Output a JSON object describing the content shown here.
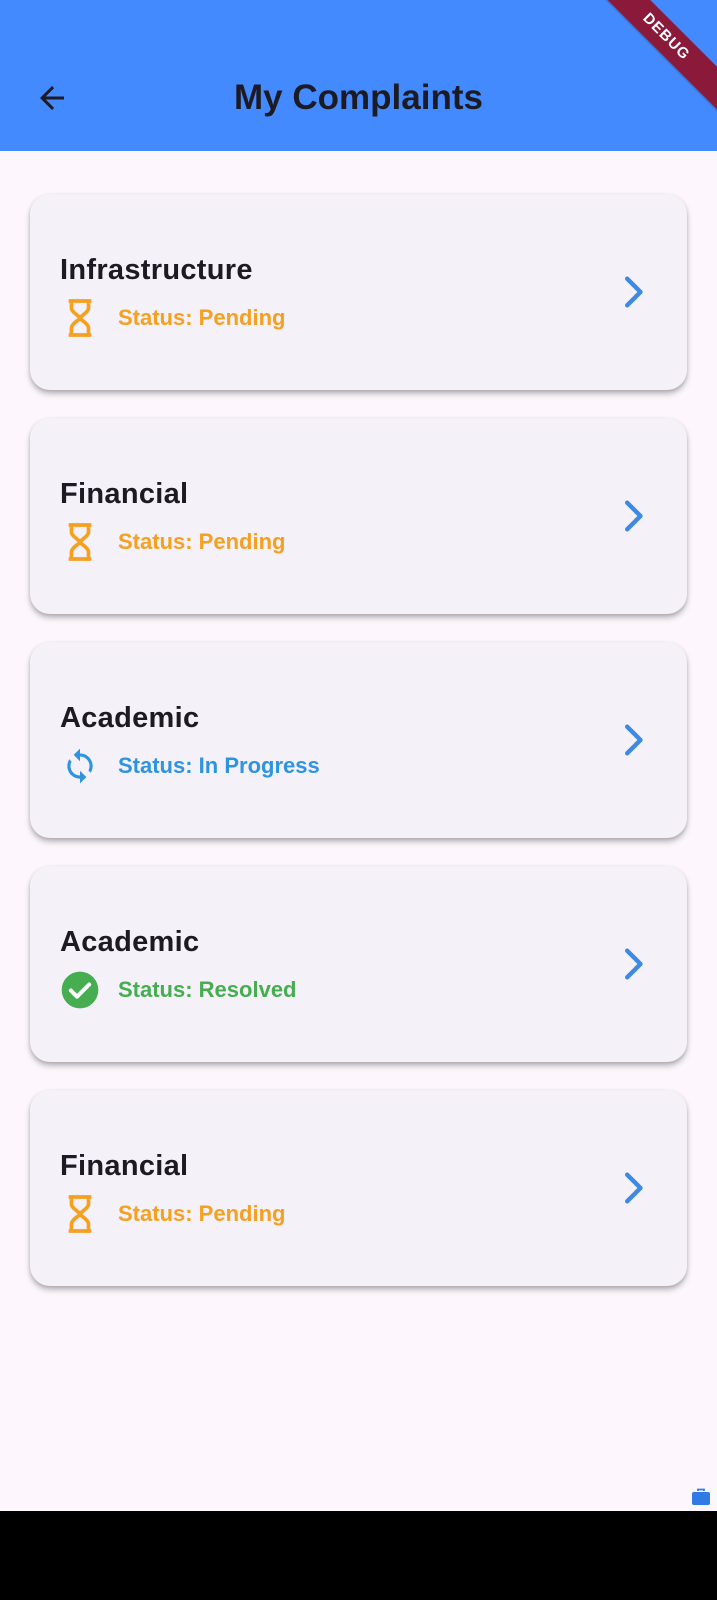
{
  "app_bar": {
    "title": "My Complaints",
    "background_color": "#448aff",
    "back_icon": "arrow-back-icon"
  },
  "debug_banner": {
    "label": "DEBUG"
  },
  "complaints": [
    {
      "category": "Infrastructure",
      "status_text": "Status: Pending",
      "status_icon": "hourglass-icon",
      "status_color": "#f5a021"
    },
    {
      "category": "Financial",
      "status_text": "Status: Pending",
      "status_icon": "hourglass-icon",
      "status_color": "#f5a021"
    },
    {
      "category": "Academic",
      "status_text": "Status: In Progress",
      "status_icon": "sync-icon",
      "status_color": "#2f94e0"
    },
    {
      "category": "Academic",
      "status_text": "Status: Resolved",
      "status_icon": "check-circle-icon",
      "status_color": "#46ad50"
    },
    {
      "category": "Financial",
      "status_text": "Status: Pending",
      "status_icon": "hourglass-icon",
      "status_color": "#f5a021"
    }
  ],
  "chevron_icon": "chevron-right-icon",
  "chevron_color": "#3d8ae6",
  "corner_icon": "briefcase-icon"
}
